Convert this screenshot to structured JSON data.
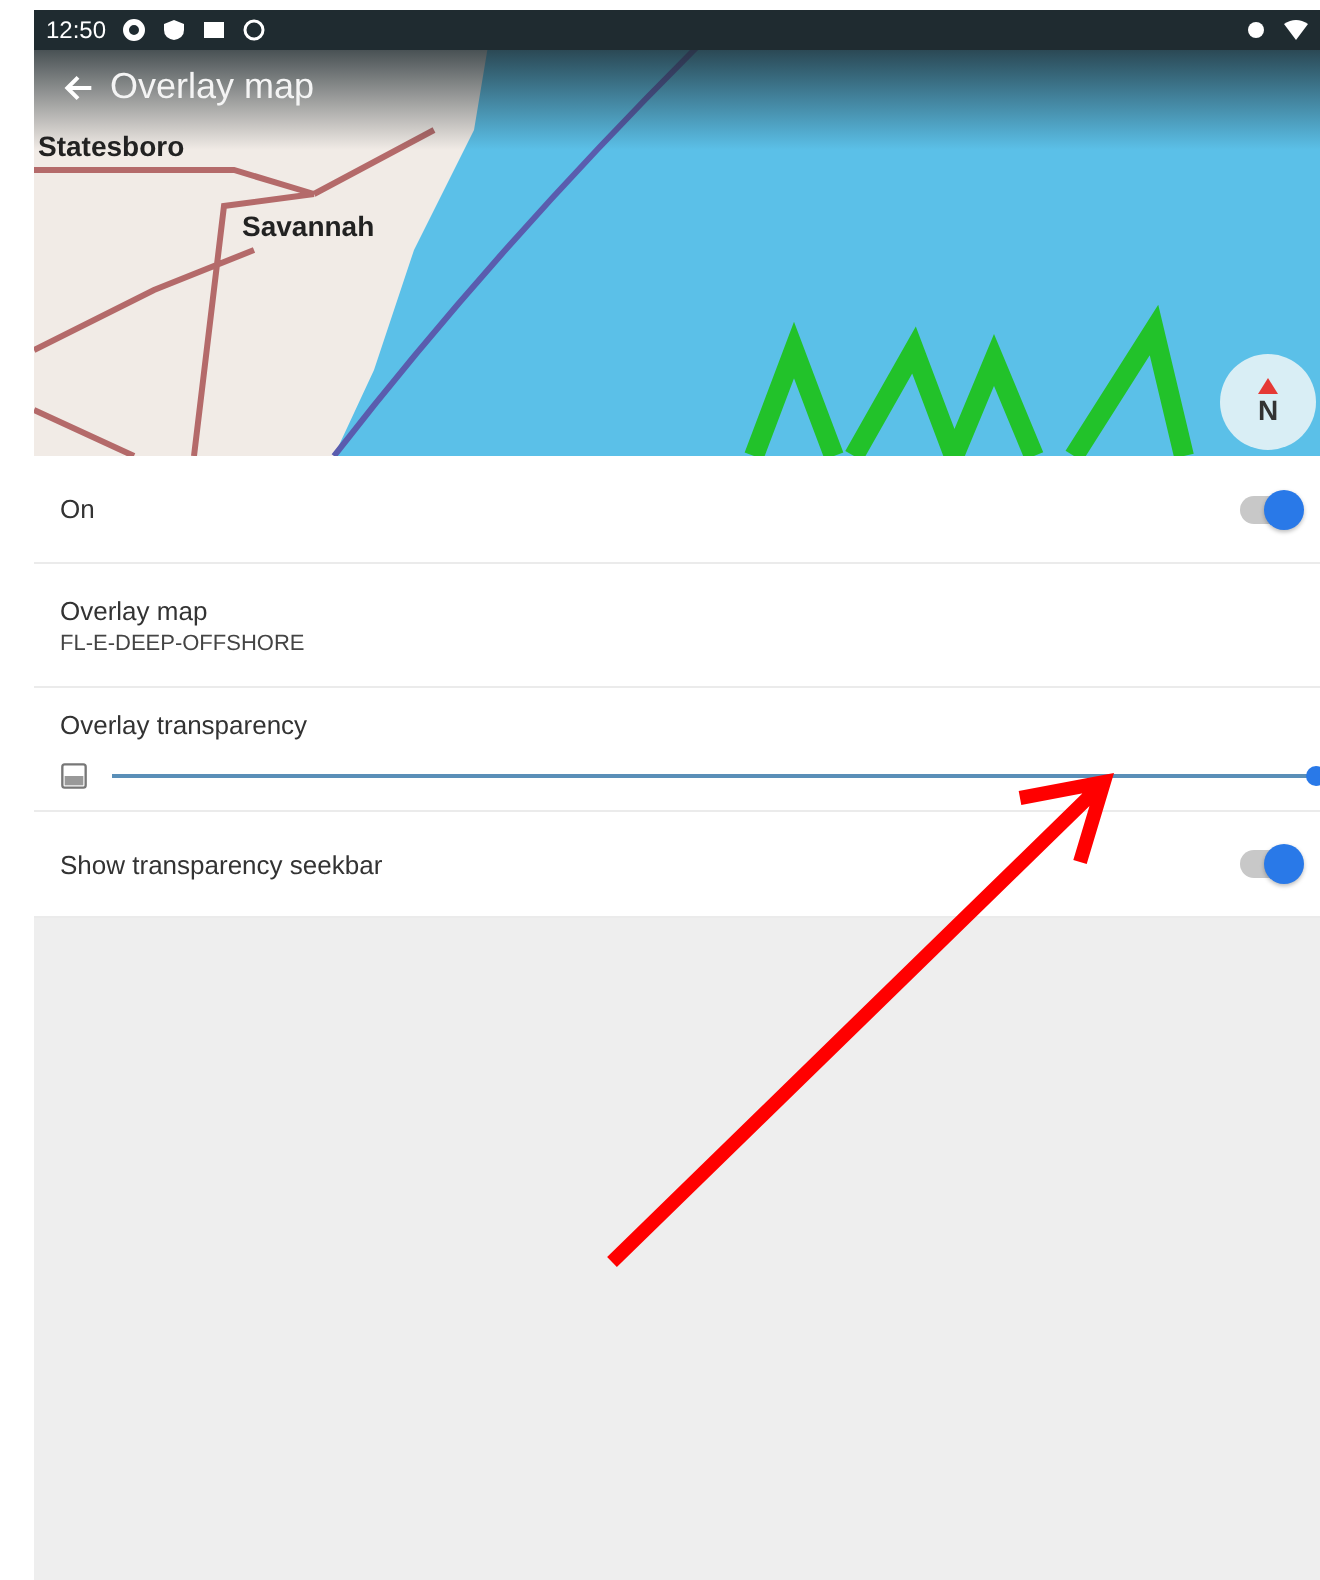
{
  "status_bar": {
    "time": "12:50"
  },
  "map": {
    "title": "Overlay map",
    "labels": [
      "Statesboro",
      "Savannah"
    ],
    "compass": "N"
  },
  "settings": [
    {
      "kind": "toggle",
      "label": "On",
      "on": true
    },
    {
      "kind": "value",
      "label": "Overlay map",
      "value": "FL-E-DEEP-OFFSHORE"
    },
    {
      "kind": "slider",
      "label": "Overlay transparency",
      "level": 1.0
    },
    {
      "kind": "toggle",
      "label": "Show transparency seekbar",
      "on": true
    }
  ]
}
